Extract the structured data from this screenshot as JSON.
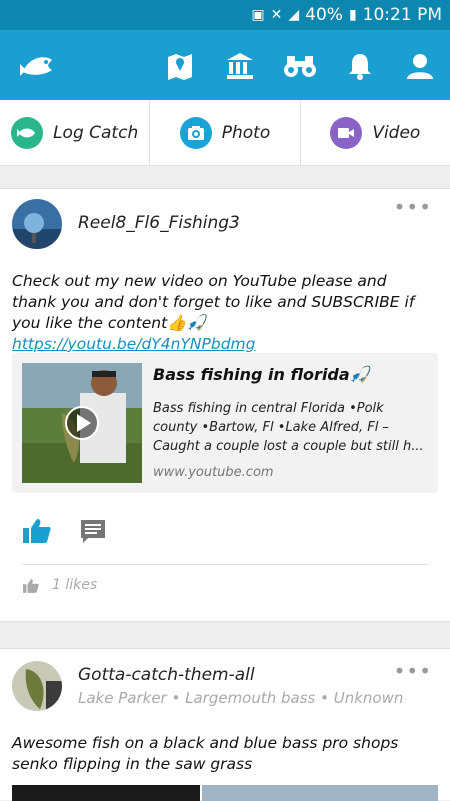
{
  "status_bar": {
    "battery": "40%",
    "time": "10:21 PM"
  },
  "actions": [
    {
      "label": "Log Catch",
      "icon": "fish-icon",
      "color": "#2bb58a"
    },
    {
      "label": "Photo",
      "icon": "camera-icon",
      "color": "#1ba3d8"
    },
    {
      "label": "Video",
      "icon": "video-icon",
      "color": "#8a63c9"
    }
  ],
  "post1": {
    "username": "Reel8_Fl6_Fishing3",
    "text": "Check out my new video on YouTube please and thank you and don't forget to like and SUBSCRIBE if you like the content👍🎣",
    "link": "https://youtu.be/dY4nYNPbdmg",
    "preview": {
      "title": "Bass fishing in florida🎣",
      "description": "Bass fishing in central Florida •Polk county •Bartow, Fl •Lake Alfred, Fl – Caught a couple lost a couple but still h...",
      "domain": "www.youtube.com"
    },
    "likes": "1 likes"
  },
  "post2": {
    "username": "Gotta-catch-them-all",
    "meta": "Lake Parker • Largemouth bass • Unknown",
    "text": "Awesome fish on a black and blue bass pro shops senko flipping in the saw grass"
  },
  "colors": {
    "header": "#1a9fd0",
    "statusbar": "#0d87b0",
    "accent": "#1a8fc0"
  }
}
